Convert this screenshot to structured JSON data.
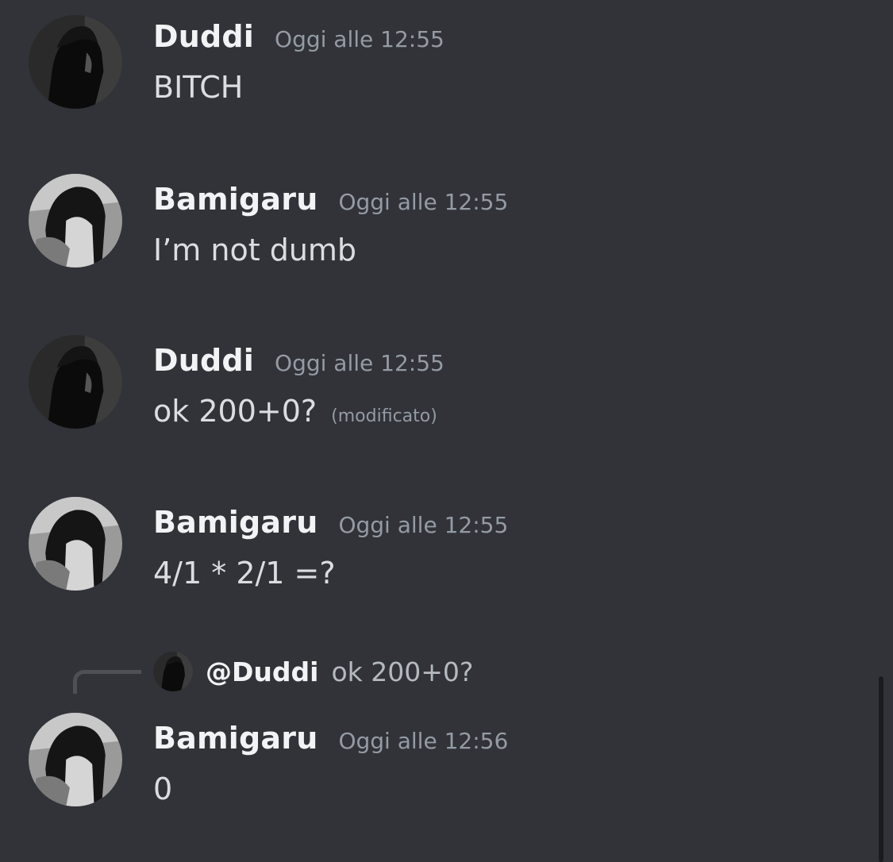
{
  "messages": [
    {
      "author": "Duddi",
      "timestamp": "Oggi alle 12:55",
      "text": "BITCH",
      "avatar": "duddi-avatar"
    },
    {
      "author": "Bamigaru",
      "timestamp": "Oggi alle 12:55",
      "text": "I’m not dumb",
      "avatar": "bamigaru-avatar"
    },
    {
      "author": "Duddi",
      "timestamp": "Oggi alle 12:55",
      "text": "ok 200+0?",
      "edited_label": "(modificato)",
      "avatar": "duddi-avatar"
    },
    {
      "author": "Bamigaru",
      "timestamp": "Oggi alle 12:55",
      "text": "4/1 * 2/1 =?",
      "avatar": "bamigaru-avatar"
    },
    {
      "author": "Bamigaru",
      "timestamp": "Oggi alle 12:56",
      "text": "0",
      "avatar": "bamigaru-avatar",
      "reply": {
        "author": "@Duddi",
        "text": "ok 200+0?"
      }
    }
  ],
  "colors": {
    "background": "#313338",
    "username": "#f2f3f5",
    "timestamp": "#949ba4",
    "message_text": "#dbdee1"
  }
}
